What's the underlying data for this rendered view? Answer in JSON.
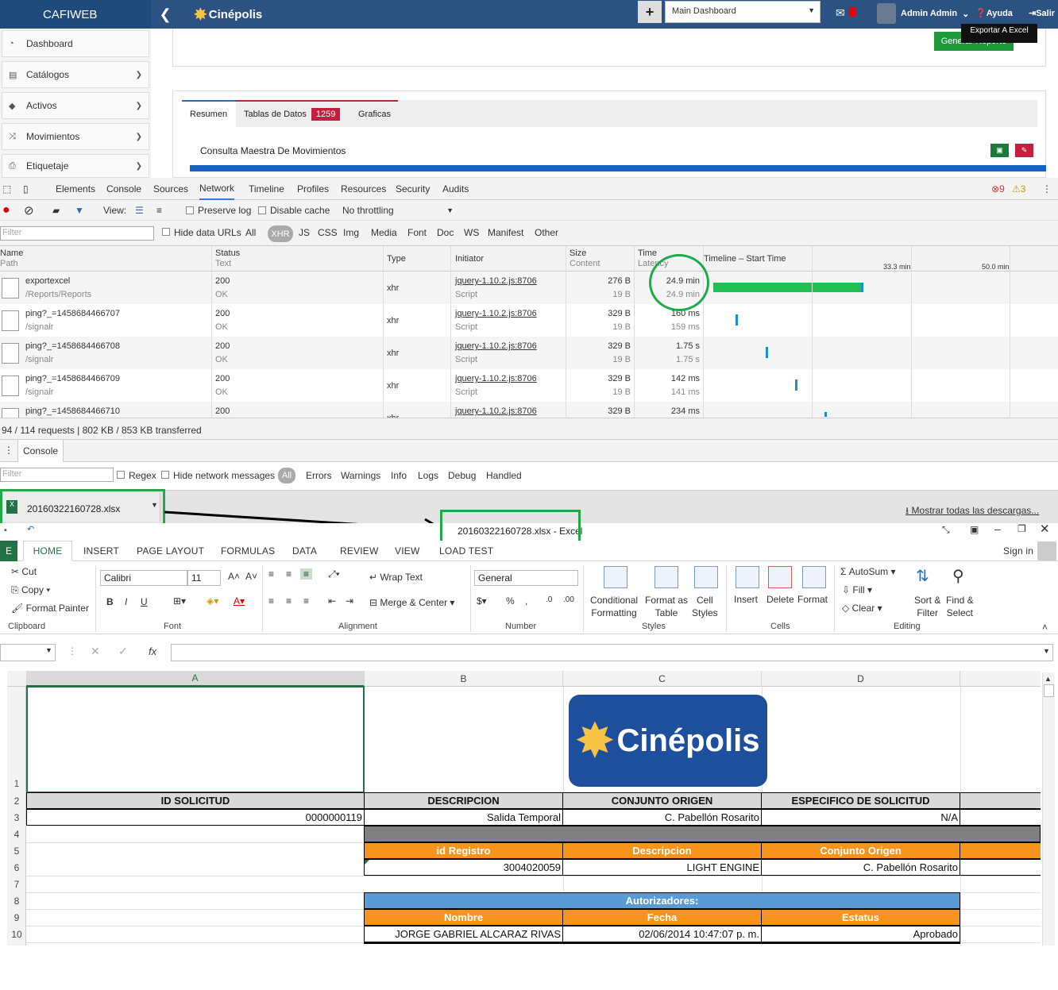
{
  "web": {
    "brand": "CAFIWEB",
    "logo": "Cinépolis",
    "dashboard_select": "Main Dashboard",
    "admin": "Admin Admin",
    "help": "Ayuda",
    "exit": "Salir",
    "generate_button": "Generar Reporte",
    "tooltip": "Exportar A Excel",
    "sidebar": [
      {
        "label": "Dashboard",
        "icon": "dashboard-icon"
      },
      {
        "label": "Catálogos",
        "icon": "book-icon"
      },
      {
        "label": "Activos",
        "icon": "tags-icon"
      },
      {
        "label": "Movimientos",
        "icon": "shuffle-icon"
      },
      {
        "label": "Etiquetaje",
        "icon": "print-icon"
      }
    ],
    "tabs": {
      "resumen": "Resumen",
      "tablas": "Tablas de Datos",
      "tablas_count": "1259",
      "graficas": "Graficas"
    },
    "section_title": "Consulta Maestra De Movimientos"
  },
  "devtools": {
    "tabs": [
      "Elements",
      "Console",
      "Sources",
      "Network",
      "Timeline",
      "Profiles",
      "Resources",
      "Security",
      "Audits"
    ],
    "active_tab": "Network",
    "errors": "9",
    "warnings": "3",
    "toolbar": {
      "view": "View:",
      "preserve_log": "Preserve log",
      "disable_cache": "Disable cache",
      "throttling": "No throttling"
    },
    "filter": {
      "placeholder": "Filter",
      "hide_data_urls": "Hide data URLs",
      "types": [
        "All",
        "XHR",
        "JS",
        "CSS",
        "Img",
        "Media",
        "Font",
        "Doc",
        "WS",
        "Manifest",
        "Other"
      ]
    },
    "columns": {
      "name": "Name",
      "path": "Path",
      "status": "Status",
      "text": "Text",
      "type": "Type",
      "initiator": "Initiator",
      "size": "Size",
      "content": "Content",
      "time": "Time",
      "latency": "Latency",
      "timeline": "Timeline – Start Time",
      "t1": "33.3 min",
      "t2": "50.0 min"
    },
    "rows": [
      {
        "name": "exportexcel",
        "path": "/Reports/Reports",
        "status": "200",
        "text": "OK",
        "type": "xhr",
        "initiator": "jquery-1.10.2.js:8706",
        "init2": "Script",
        "size": "276 B",
        "content": "19 B",
        "time": "24.9 min",
        "latency": "24.9 min"
      },
      {
        "name": "ping?_=1458684466707",
        "path": "/signalr",
        "status": "200",
        "text": "OK",
        "type": "xhr",
        "initiator": "jquery-1.10.2.js:8706",
        "init2": "Script",
        "size": "329 B",
        "content": "19 B",
        "time": "160 ms",
        "latency": "159 ms"
      },
      {
        "name": "ping?_=1458684466708",
        "path": "/signalr",
        "status": "200",
        "text": "OK",
        "type": "xhr",
        "initiator": "jquery-1.10.2.js:8706",
        "init2": "Script",
        "size": "329 B",
        "content": "19 B",
        "time": "1.75 s",
        "latency": "1.75 s"
      },
      {
        "name": "ping?_=1458684466709",
        "path": "/signalr",
        "status": "200",
        "text": "OK",
        "type": "xhr",
        "initiator": "jquery-1.10.2.js:8706",
        "init2": "Script",
        "size": "329 B",
        "content": "19 B",
        "time": "142 ms",
        "latency": "141 ms"
      },
      {
        "name": "ping?_=1458684466710",
        "path": "",
        "status": "200",
        "text": "",
        "type": "xhr",
        "initiator": "jquery-1.10.2.js:8706",
        "init2": "",
        "size": "329 B",
        "content": "",
        "time": "234 ms",
        "latency": ""
      }
    ],
    "summary": "94 / 114 requests  |  802 KB / 853 KB transferred",
    "console": {
      "tab": "Console",
      "filter": "Filter",
      "regex": "Regex",
      "hide_network": "Hide network messages",
      "levels": [
        "All",
        "Errors",
        "Warnings",
        "Info",
        "Logs",
        "Debug",
        "Handled"
      ]
    }
  },
  "download": {
    "file": "20160322160728.xlsx",
    "show_all": "Mostrar todas las descargas..."
  },
  "excel": {
    "title": "20160322160728.xlsx - Excel",
    "sign_in": "Sign in",
    "file_tab": "E",
    "tabs": [
      "HOME",
      "INSERT",
      "PAGE LAYOUT",
      "FORMULAS",
      "DATA",
      "REVIEW",
      "VIEW",
      "LOAD TEST"
    ],
    "ribbon": {
      "cut": "Cut",
      "copy": "Copy",
      "format_painter": "Format Painter",
      "font": "Calibri",
      "size": "11",
      "wrap": "Wrap Text",
      "merge": "Merge & Center",
      "number_format": "General",
      "cond": "Conditional",
      "cond2": "Formatting",
      "fmt_table": "Format as",
      "fmt_table2": "Table",
      "cell_styles": "Cell",
      "cell_styles2": "Styles",
      "insert": "Insert",
      "delete": "Delete",
      "format": "Format",
      "autosum": "AutoSum",
      "fill": "Fill",
      "clear": "Clear",
      "sort": "Sort &",
      "sort2": "Filter",
      "find": "Find &",
      "find2": "Select",
      "groups": [
        "Clipboard",
        "Font",
        "Alignment",
        "Number",
        "Styles",
        "Cells",
        "Editing"
      ]
    },
    "columns": [
      "A",
      "B",
      "C",
      "D"
    ],
    "rows": [
      "1",
      "2",
      "3",
      "4",
      "5",
      "6",
      "7",
      "8",
      "9",
      "10"
    ],
    "sheet": {
      "logo": "Cinépolis",
      "h1": [
        "ID SOLICITUD",
        "DESCRIPCION",
        "CONJUNTO ORIGEN",
        "ESPECIFICO DE SOLICITUD"
      ],
      "r3": [
        "0000000119",
        "Salida Temporal",
        "C. Pabellón Rosarito",
        "N/A"
      ],
      "h2": [
        "id Registro",
        "Descripcion",
        "Conjunto Origen"
      ],
      "r6": [
        "3004020059",
        "LIGHT ENGINE",
        "C. Pabellón Rosarito"
      ],
      "autorizadores": "Autorizadores:",
      "h3": [
        "Nombre",
        "Fecha",
        "Estatus"
      ],
      "r10": [
        "JORGE GABRIEL ALCARAZ RIVAS",
        "02/06/2014 10:47:07 p. m.",
        "Aprobado"
      ]
    }
  },
  "chart_colors": {
    "highlight": "#1faa48",
    "brand_blue": "#1e4f9c",
    "orange": "#f7941d"
  }
}
